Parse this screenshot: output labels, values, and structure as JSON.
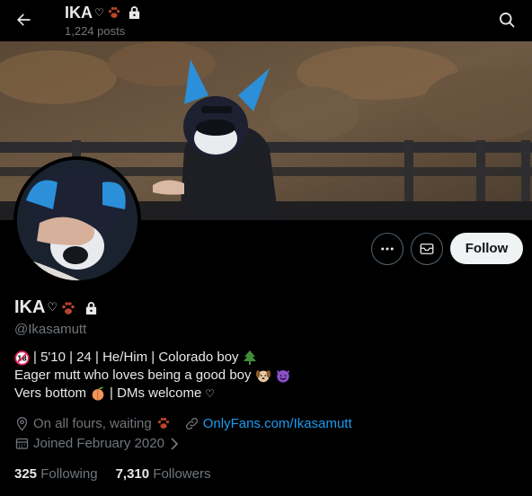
{
  "header": {
    "name": "IKA",
    "post_count": "1,224 posts"
  },
  "profile": {
    "name": "IKA",
    "handle": "@Ikasamutt",
    "bio": {
      "line1": "| 5'10 | 24 | He/Him | Colorado boy",
      "line2": "Eager mutt who loves being a good boy",
      "line3a": "Vers bottom",
      "line3b": "| DMs welcome"
    },
    "location": "On all fours, waiting",
    "website": "OnlyFans.com/Ikasamutt",
    "joined": "Joined February 2020"
  },
  "actions": {
    "follow_label": "Follow"
  },
  "stats": {
    "following_count": "325",
    "following_label": "Following",
    "followers_count": "7,310",
    "followers_label": "Followers"
  },
  "colors": {
    "accent": "#1d9bf0",
    "muted": "#71767b",
    "text": "#e7e9ea",
    "background": "#000000"
  }
}
